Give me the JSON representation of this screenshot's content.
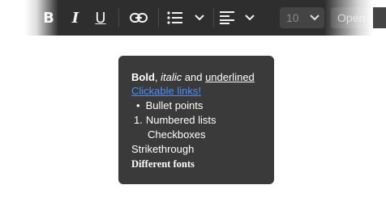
{
  "toolbar": {
    "bold_label": "B",
    "italic_label": "I",
    "underline_label": "U",
    "font_size_value": "10",
    "font_name_value": "Open"
  },
  "tooltip": {
    "line1_bold": "Bold",
    "line1_sep": ", ",
    "line1_italic": "italic",
    "line1_and": " and ",
    "line1_underline": "underlined",
    "link_text": "Clickable links!",
    "bullet_marker": "•",
    "bullet_text": "Bullet points",
    "numbered_marker": "1.",
    "numbered_text": "Numbered lists",
    "checkbox_text": "Checkboxes",
    "strikethrough_text": "Strikethrough",
    "fonts_text": "Different fonts"
  },
  "colors": {
    "toolbar_bg": "#2e2e2e",
    "tooltip_bg": "#3a3a3a",
    "link": "#4f8ef7"
  }
}
